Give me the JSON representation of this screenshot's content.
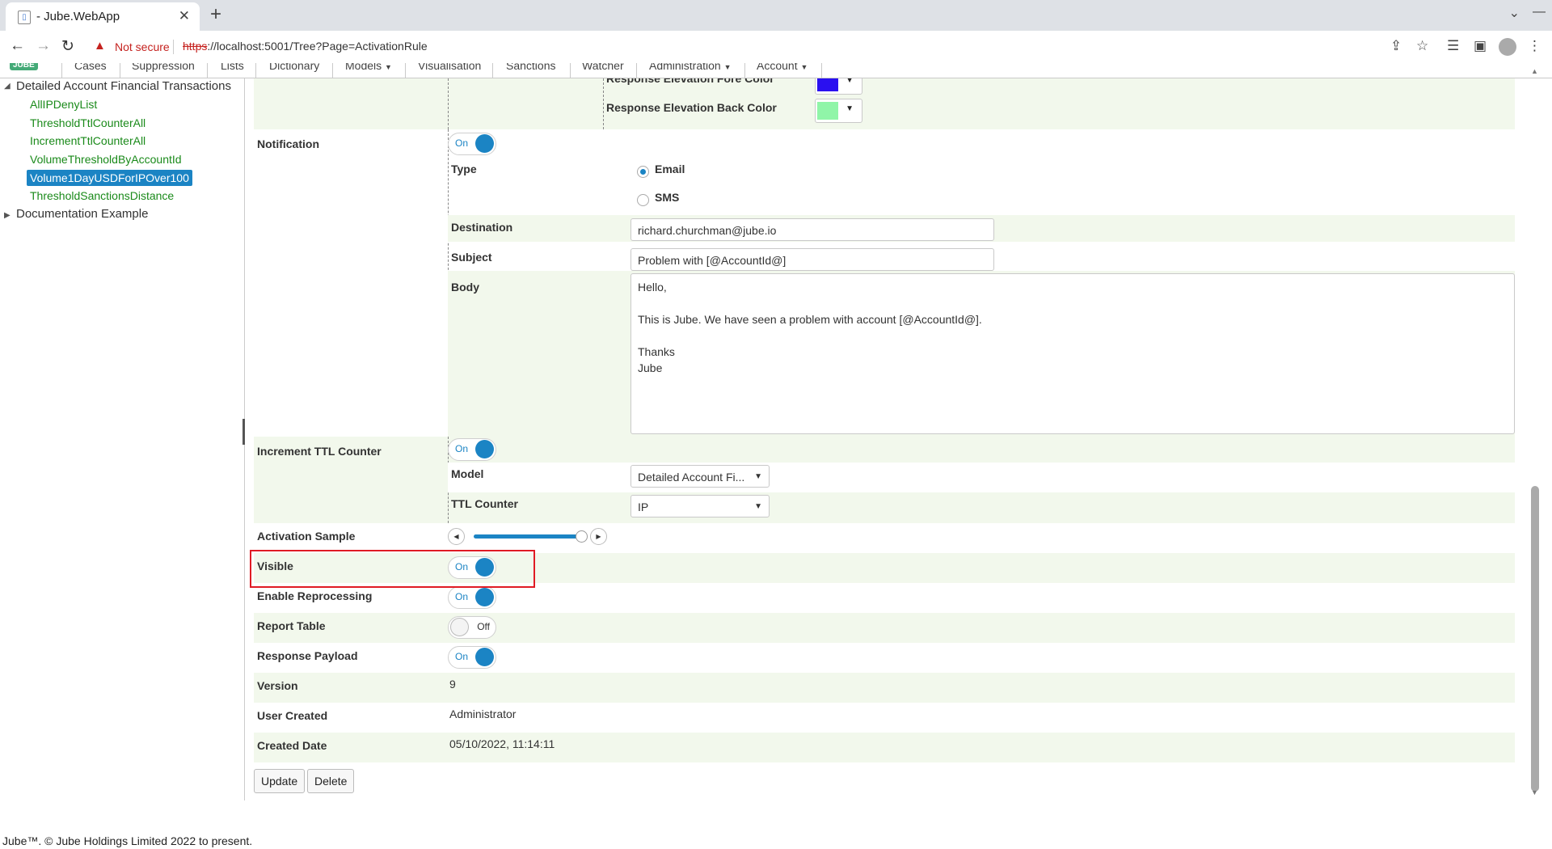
{
  "browser": {
    "tab_title": "- Jube.WebApp",
    "not_secure": "Not secure",
    "url_scheme": "https",
    "url_rest": "://localhost:5001/Tree?Page=ActivationRule"
  },
  "nav": {
    "logo": "JUBE",
    "menus": [
      "Cases",
      "Suppression",
      "Lists",
      "Dictionary",
      "Models",
      "Visualisation",
      "Sanctions",
      "Watcher",
      "Administration",
      "Account"
    ]
  },
  "tree": {
    "root1": "Detailed Account Financial Transactions",
    "leaves": [
      "AllIPDenyList",
      "ThresholdTtlCounterAll",
      "IncrementTtlCounterAll",
      "VolumeThresholdByAccountId",
      "Volume1DayUSDForIPOver100",
      "ThresholdSanctionsDistance"
    ],
    "root2": "Documentation Example"
  },
  "form": {
    "response_fore_label": "Response Elevation Fore Color",
    "response_fore_color": "#2a10f0",
    "response_back_label": "Response Elevation Back Color",
    "response_back_color": "#90f5a8",
    "notification_label": "Notification",
    "notification_state": "On",
    "type_label": "Type",
    "type_email": "Email",
    "type_sms": "SMS",
    "destination_label": "Destination",
    "destination_value": "richard.churchman@jube.io",
    "subject_label": "Subject",
    "subject_value": "Problem with [@AccountId@]",
    "body_label": "Body",
    "body_value": "Hello,\n\nThis is Jube.  We have seen a problem with account [@AccountId@].\n\nThanks\nJube",
    "increment_label": "Increment TTL Counter",
    "increment_state": "On",
    "model_label": "Model",
    "model_value": "Detailed Account Fi...",
    "ttl_counter_label": "TTL Counter",
    "ttl_counter_value": "IP",
    "activation_sample_label": "Activation Sample",
    "activation_sample_fraction": 0.98,
    "visible_label": "Visible",
    "visible_state": "On",
    "enable_reprocessing_label": "Enable Reprocessing",
    "enable_reprocessing_state": "On",
    "report_table_label": "Report Table",
    "report_table_state": "Off",
    "response_payload_label": "Response Payload",
    "response_payload_state": "On",
    "version_label": "Version",
    "version_value": "9",
    "user_created_label": "User Created",
    "user_created_value": "Administrator",
    "created_date_label": "Created Date",
    "created_date_value": "05/10/2022, 11:14:11",
    "update_button": "Update",
    "delete_button": "Delete"
  },
  "footer": "Jube™. © Jube Holdings Limited 2022 to present."
}
